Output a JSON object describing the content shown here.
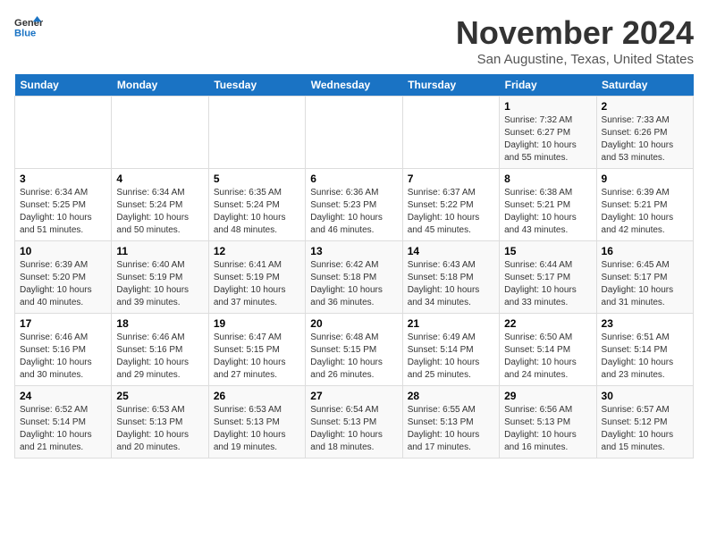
{
  "logo": {
    "line1": "General",
    "line2": "Blue"
  },
  "title": "November 2024",
  "subtitle": "San Augustine, Texas, United States",
  "days_header": [
    "Sunday",
    "Monday",
    "Tuesday",
    "Wednesday",
    "Thursday",
    "Friday",
    "Saturday"
  ],
  "weeks": [
    [
      {
        "day": "",
        "info": ""
      },
      {
        "day": "",
        "info": ""
      },
      {
        "day": "",
        "info": ""
      },
      {
        "day": "",
        "info": ""
      },
      {
        "day": "",
        "info": ""
      },
      {
        "day": "1",
        "info": "Sunrise: 7:32 AM\nSunset: 6:27 PM\nDaylight: 10 hours\nand 55 minutes."
      },
      {
        "day": "2",
        "info": "Sunrise: 7:33 AM\nSunset: 6:26 PM\nDaylight: 10 hours\nand 53 minutes."
      }
    ],
    [
      {
        "day": "3",
        "info": "Sunrise: 6:34 AM\nSunset: 5:25 PM\nDaylight: 10 hours\nand 51 minutes."
      },
      {
        "day": "4",
        "info": "Sunrise: 6:34 AM\nSunset: 5:24 PM\nDaylight: 10 hours\nand 50 minutes."
      },
      {
        "day": "5",
        "info": "Sunrise: 6:35 AM\nSunset: 5:24 PM\nDaylight: 10 hours\nand 48 minutes."
      },
      {
        "day": "6",
        "info": "Sunrise: 6:36 AM\nSunset: 5:23 PM\nDaylight: 10 hours\nand 46 minutes."
      },
      {
        "day": "7",
        "info": "Sunrise: 6:37 AM\nSunset: 5:22 PM\nDaylight: 10 hours\nand 45 minutes."
      },
      {
        "day": "8",
        "info": "Sunrise: 6:38 AM\nSunset: 5:21 PM\nDaylight: 10 hours\nand 43 minutes."
      },
      {
        "day": "9",
        "info": "Sunrise: 6:39 AM\nSunset: 5:21 PM\nDaylight: 10 hours\nand 42 minutes."
      }
    ],
    [
      {
        "day": "10",
        "info": "Sunrise: 6:39 AM\nSunset: 5:20 PM\nDaylight: 10 hours\nand 40 minutes."
      },
      {
        "day": "11",
        "info": "Sunrise: 6:40 AM\nSunset: 5:19 PM\nDaylight: 10 hours\nand 39 minutes."
      },
      {
        "day": "12",
        "info": "Sunrise: 6:41 AM\nSunset: 5:19 PM\nDaylight: 10 hours\nand 37 minutes."
      },
      {
        "day": "13",
        "info": "Sunrise: 6:42 AM\nSunset: 5:18 PM\nDaylight: 10 hours\nand 36 minutes."
      },
      {
        "day": "14",
        "info": "Sunrise: 6:43 AM\nSunset: 5:18 PM\nDaylight: 10 hours\nand 34 minutes."
      },
      {
        "day": "15",
        "info": "Sunrise: 6:44 AM\nSunset: 5:17 PM\nDaylight: 10 hours\nand 33 minutes."
      },
      {
        "day": "16",
        "info": "Sunrise: 6:45 AM\nSunset: 5:17 PM\nDaylight: 10 hours\nand 31 minutes."
      }
    ],
    [
      {
        "day": "17",
        "info": "Sunrise: 6:46 AM\nSunset: 5:16 PM\nDaylight: 10 hours\nand 30 minutes."
      },
      {
        "day": "18",
        "info": "Sunrise: 6:46 AM\nSunset: 5:16 PM\nDaylight: 10 hours\nand 29 minutes."
      },
      {
        "day": "19",
        "info": "Sunrise: 6:47 AM\nSunset: 5:15 PM\nDaylight: 10 hours\nand 27 minutes."
      },
      {
        "day": "20",
        "info": "Sunrise: 6:48 AM\nSunset: 5:15 PM\nDaylight: 10 hours\nand 26 minutes."
      },
      {
        "day": "21",
        "info": "Sunrise: 6:49 AM\nSunset: 5:14 PM\nDaylight: 10 hours\nand 25 minutes."
      },
      {
        "day": "22",
        "info": "Sunrise: 6:50 AM\nSunset: 5:14 PM\nDaylight: 10 hours\nand 24 minutes."
      },
      {
        "day": "23",
        "info": "Sunrise: 6:51 AM\nSunset: 5:14 PM\nDaylight: 10 hours\nand 23 minutes."
      }
    ],
    [
      {
        "day": "24",
        "info": "Sunrise: 6:52 AM\nSunset: 5:14 PM\nDaylight: 10 hours\nand 21 minutes."
      },
      {
        "day": "25",
        "info": "Sunrise: 6:53 AM\nSunset: 5:13 PM\nDaylight: 10 hours\nand 20 minutes."
      },
      {
        "day": "26",
        "info": "Sunrise: 6:53 AM\nSunset: 5:13 PM\nDaylight: 10 hours\nand 19 minutes."
      },
      {
        "day": "27",
        "info": "Sunrise: 6:54 AM\nSunset: 5:13 PM\nDaylight: 10 hours\nand 18 minutes."
      },
      {
        "day": "28",
        "info": "Sunrise: 6:55 AM\nSunset: 5:13 PM\nDaylight: 10 hours\nand 17 minutes."
      },
      {
        "day": "29",
        "info": "Sunrise: 6:56 AM\nSunset: 5:13 PM\nDaylight: 10 hours\nand 16 minutes."
      },
      {
        "day": "30",
        "info": "Sunrise: 6:57 AM\nSunset: 5:12 PM\nDaylight: 10 hours\nand 15 minutes."
      }
    ]
  ]
}
